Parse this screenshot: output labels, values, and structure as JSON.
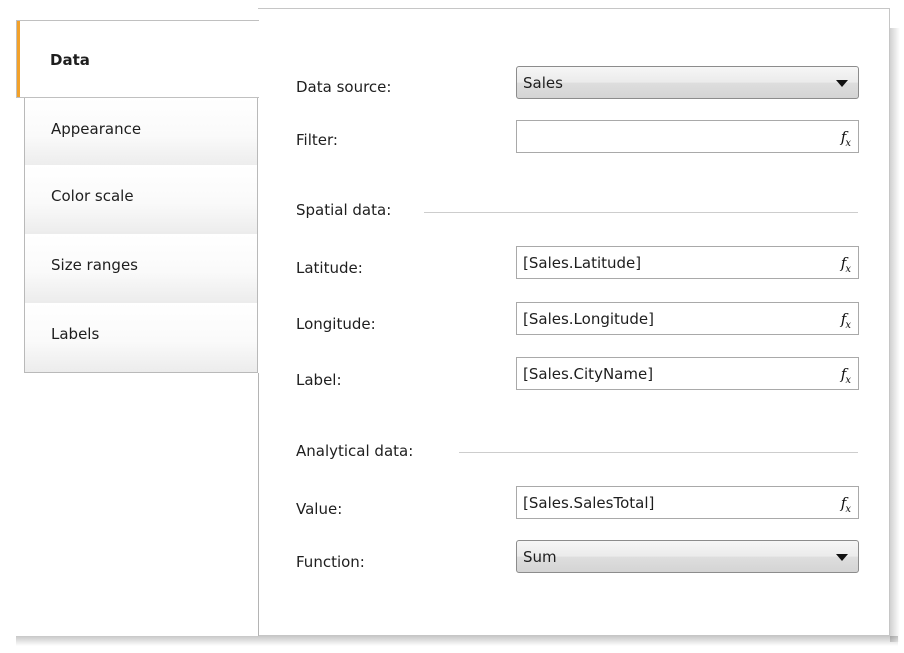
{
  "tabs": [
    {
      "label": "Data",
      "active": true
    },
    {
      "label": "Appearance"
    },
    {
      "label": "Color scale"
    },
    {
      "label": "Size ranges"
    },
    {
      "label": "Labels"
    }
  ],
  "form": {
    "data_source": {
      "label": "Data source:",
      "value": "Sales"
    },
    "filter": {
      "label": "Filter:",
      "value": "",
      "fx": "fx"
    },
    "spatial_section": "Spatial data:",
    "latitude": {
      "label": "Latitude:",
      "value": "[Sales.Latitude]",
      "fx": "fx"
    },
    "longitude": {
      "label": "Longitude:",
      "value": "[Sales.Longitude]",
      "fx": "fx"
    },
    "label_field": {
      "label": "Label:",
      "value": "[Sales.CityName]",
      "fx": "fx"
    },
    "analytical_section": "Analytical data:",
    "value_field": {
      "label": "Value:",
      "value": "[Sales.SalesTotal]",
      "fx": "fx"
    },
    "function": {
      "label": "Function:",
      "value": "Sum"
    }
  },
  "colors": {
    "active_tab_accent": "#f2a12a",
    "border": "#a9a9a9"
  },
  "icons": {
    "combo_arrow": "chevron-down-icon",
    "expression": "fx-icon"
  }
}
